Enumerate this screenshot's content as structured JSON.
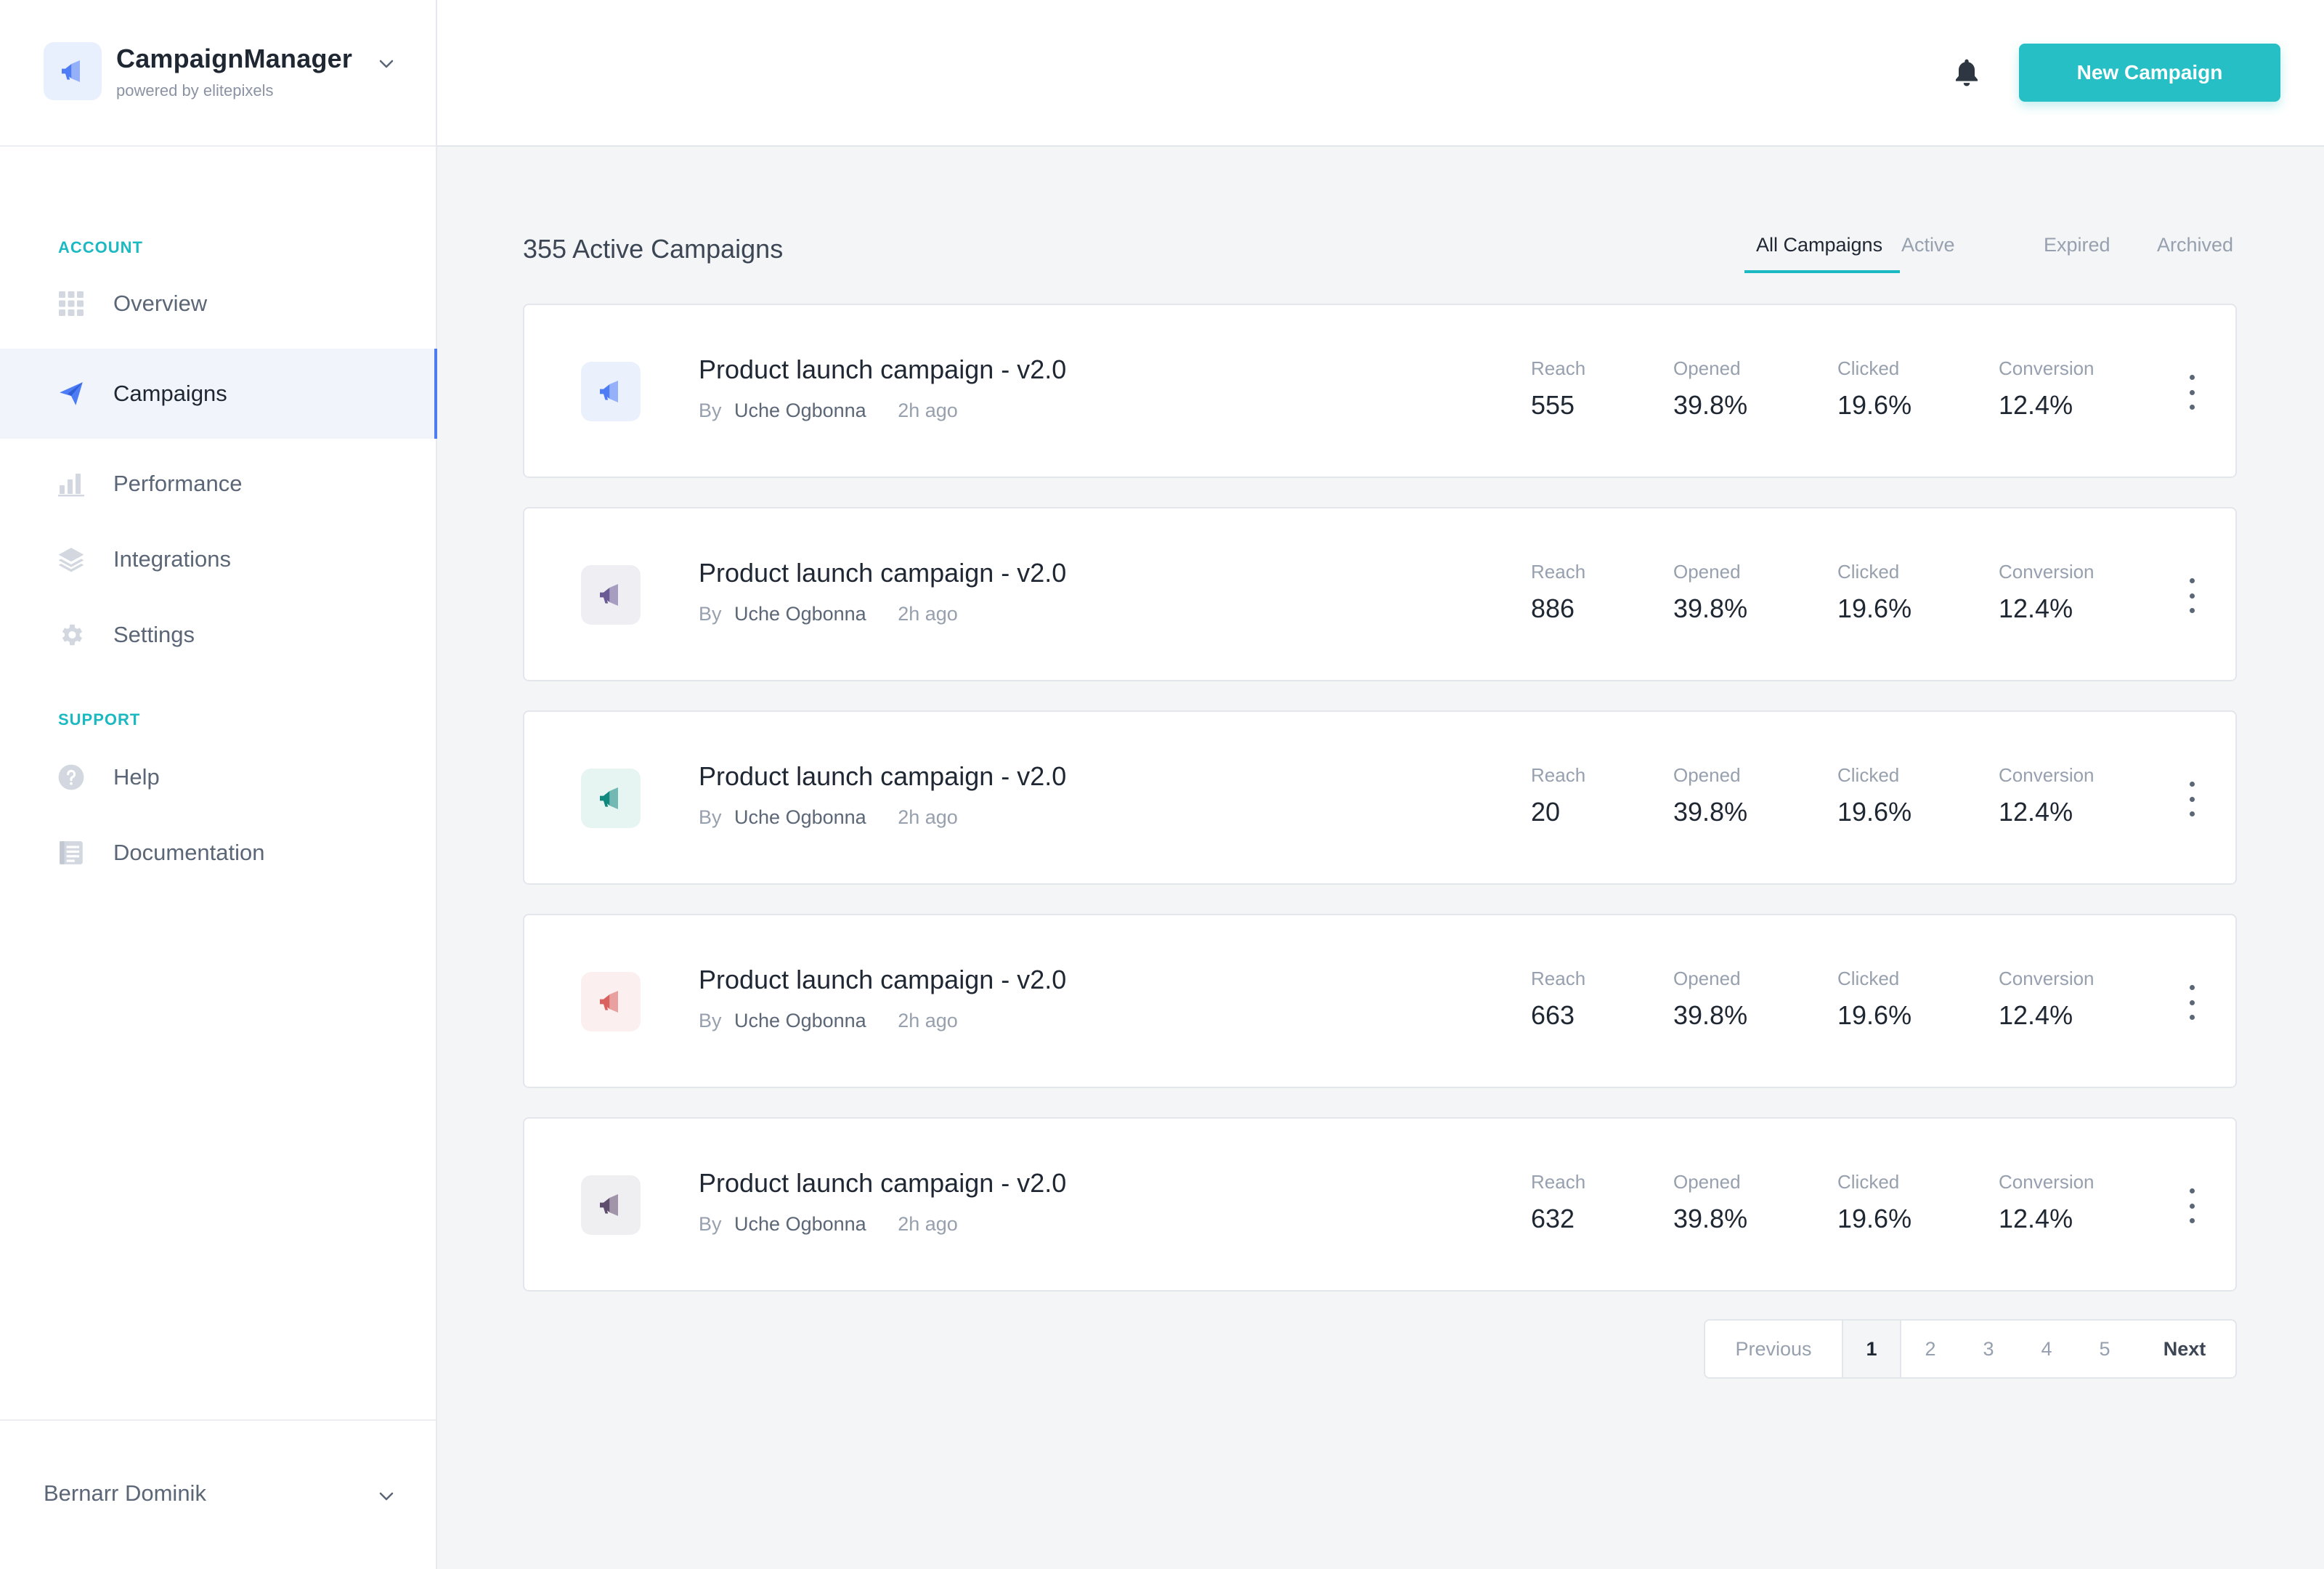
{
  "app": {
    "name": "CampaignManager",
    "subtitle": "powered by elitepixels"
  },
  "sidebar": {
    "sections": [
      {
        "title": "ACCOUNT",
        "items": [
          {
            "label": "Overview",
            "icon": "grid-icon",
            "active": false
          },
          {
            "label": "Campaigns",
            "icon": "paper-plane-icon",
            "active": true
          },
          {
            "label": "Performance",
            "icon": "bar-chart-icon",
            "active": false
          },
          {
            "label": "Integrations",
            "icon": "layers-icon",
            "active": false
          },
          {
            "label": "Settings",
            "icon": "gear-icon",
            "active": false
          }
        ]
      },
      {
        "title": "SUPPORT",
        "items": [
          {
            "label": "Help",
            "icon": "help-circle-icon",
            "active": false
          },
          {
            "label": "Documentation",
            "icon": "document-icon",
            "active": false
          }
        ]
      }
    ],
    "user": {
      "name": "Bernarr Dominik"
    }
  },
  "header": {
    "new_campaign_label": "New Campaign",
    "notification_icon": "bell-icon"
  },
  "main": {
    "title": "355 Active Campaigns",
    "tabs": [
      {
        "label": "All Campaigns",
        "active": true
      },
      {
        "label": "Active",
        "active": false
      },
      {
        "label": "Expired",
        "active": false
      },
      {
        "label": "Archived",
        "active": false
      }
    ],
    "stat_labels": {
      "reach": "Reach",
      "opened": "Opened",
      "clicked": "Clicked",
      "conversion": "Conversion"
    },
    "campaigns": [
      {
        "title": "Product launch campaign - v2.0",
        "by": "By",
        "author": "Uche Ogbonna",
        "time": "2h ago",
        "reach": "555",
        "opened": "39.8%",
        "clicked": "19.6%",
        "conversion": "12.4%",
        "icon_color": "#4d7cf5",
        "icon_bg": "#eaf1fd"
      },
      {
        "title": "Product launch campaign - v2.0",
        "by": "By",
        "author": "Uche Ogbonna",
        "time": "2h ago",
        "reach": "886",
        "opened": "39.8%",
        "clicked": "19.6%",
        "conversion": "12.4%",
        "icon_color": "#6b5b95",
        "icon_bg": "#efeef3"
      },
      {
        "title": "Product launch campaign - v2.0",
        "by": "By",
        "author": "Uche Ogbonna",
        "time": "2h ago",
        "reach": "20",
        "opened": "39.8%",
        "clicked": "19.6%",
        "conversion": "12.4%",
        "icon_color": "#10887d",
        "icon_bg": "#e6f4f2"
      },
      {
        "title": "Product launch campaign - v2.0",
        "by": "By",
        "author": "Uche Ogbonna",
        "time": "2h ago",
        "reach": "663",
        "opened": "39.8%",
        "clicked": "19.6%",
        "conversion": "12.4%",
        "icon_color": "#d9615f",
        "icon_bg": "#fcefef"
      },
      {
        "title": "Product launch campaign - v2.0",
        "by": "By",
        "author": "Uche Ogbonna",
        "time": "2h ago",
        "reach": "632",
        "opened": "39.8%",
        "clicked": "19.6%",
        "conversion": "12.4%",
        "icon_color": "#5f4d6e",
        "icon_bg": "#efeef1"
      }
    ]
  },
  "pagination": {
    "previous": "Previous",
    "pages": [
      "1",
      "2",
      "3",
      "4",
      "5"
    ],
    "current": "1",
    "next": "Next"
  },
  "colors": {
    "accent": "#1bb9c1",
    "primary_button": "#25bfc5",
    "active_nav": "#4d7cf5"
  }
}
